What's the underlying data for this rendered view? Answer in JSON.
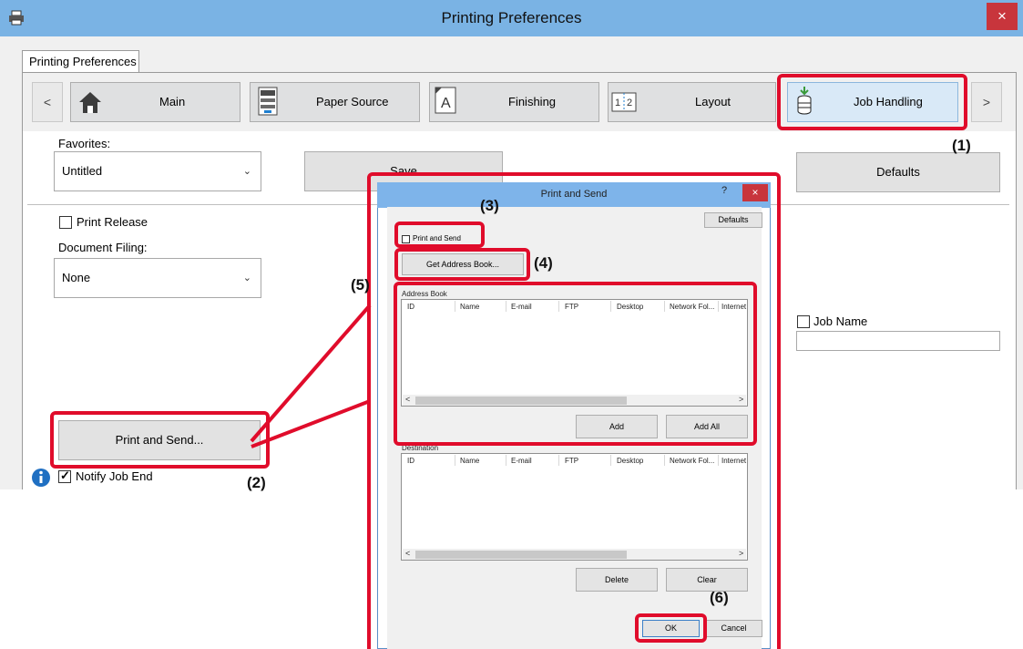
{
  "window": {
    "title": "Printing Preferences",
    "close_glyph": "×"
  },
  "tab": {
    "label": "Printing Preferences"
  },
  "ribbon": {
    "prev_glyph": "<",
    "next_glyph": ">",
    "items": [
      {
        "label": "Main",
        "icon": "home-icon"
      },
      {
        "label": "Paper Source",
        "icon": "paper-tray-icon"
      },
      {
        "label": "Finishing",
        "icon": "finishing-icon"
      },
      {
        "label": "Layout",
        "icon": "layout-icon"
      },
      {
        "label": "Job Handling",
        "icon": "job-handling-icon",
        "selected": true
      }
    ]
  },
  "favorites": {
    "label": "Favorites:",
    "value": "Untitled",
    "save_label": "Save",
    "defaults_label": "Defaults"
  },
  "print_release": {
    "label": "Print Release",
    "checked": false
  },
  "document_filing": {
    "label": "Document Filing:",
    "value": "None"
  },
  "job_name": {
    "label": "Job Name",
    "checked": false,
    "value": ""
  },
  "print_and_send_button": {
    "label": "Print and Send..."
  },
  "notify_job_end": {
    "label": "Notify Job End",
    "checked": true
  },
  "callouts": {
    "c1": "(1)",
    "c2": "(2)",
    "c3": "(3)",
    "c4": "(4)",
    "c5": "(5)",
    "c6": "(6)"
  },
  "dialog": {
    "title": "Print and Send",
    "help_glyph": "?",
    "close_glyph": "×",
    "defaults_label": "Defaults",
    "print_and_send_checkbox": "Print and Send",
    "get_address_book_label": "Get Address Book...",
    "address_book": {
      "label": "Address Book",
      "columns": [
        "ID",
        "Name",
        "E-mail",
        "FTP",
        "Desktop",
        "Network Fol...",
        "Internet"
      ],
      "add_label": "Add",
      "add_all_label": "Add All"
    },
    "destination": {
      "label": "Destination",
      "columns": [
        "ID",
        "Name",
        "E-mail",
        "FTP",
        "Desktop",
        "Network Fol...",
        "Internet"
      ],
      "delete_label": "Delete",
      "clear_label": "Clear"
    },
    "ok_label": "OK",
    "cancel_label": "Cancel"
  },
  "colors": {
    "accent_red": "#e00c2b",
    "titlebar": "#7ab3e4",
    "close_red": "#c8353c"
  }
}
